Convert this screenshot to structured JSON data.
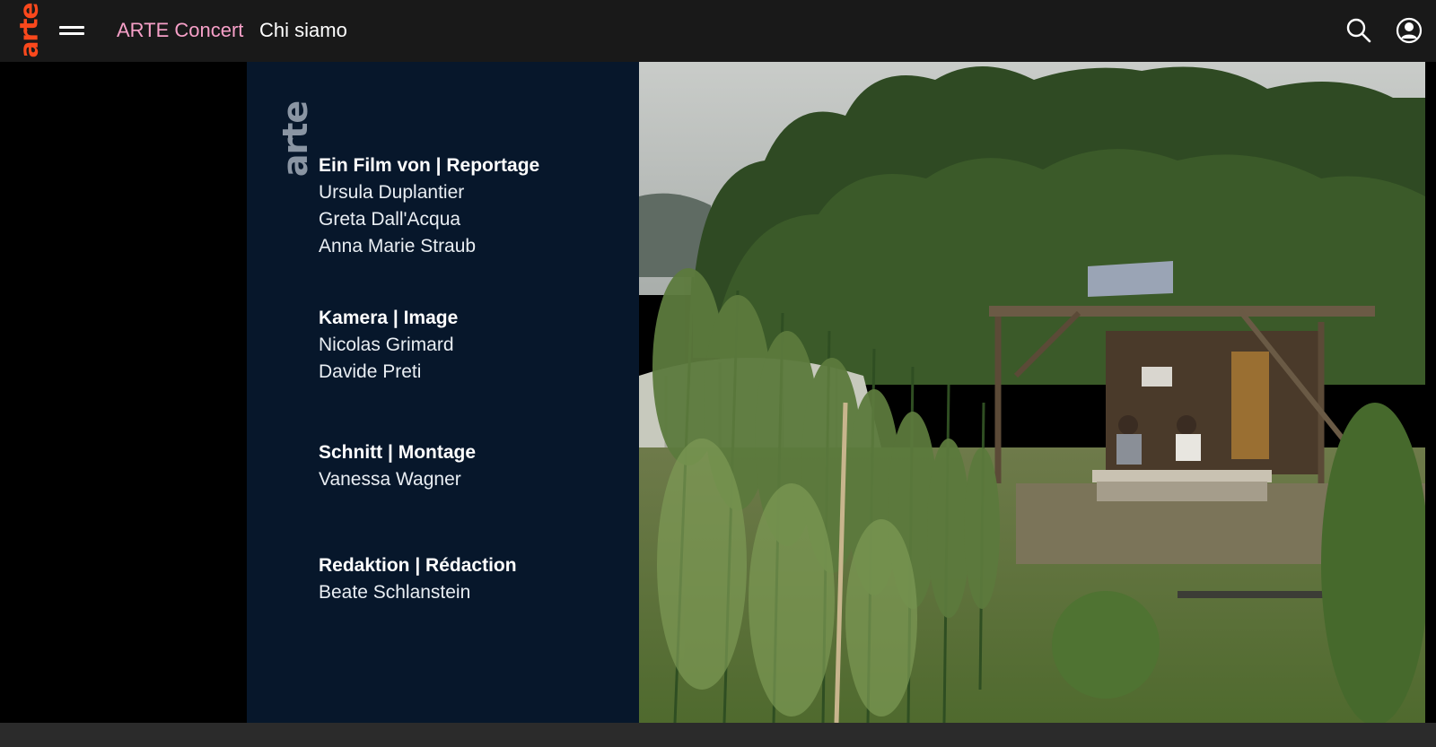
{
  "header": {
    "logo_text": "arte",
    "menu_icon": "hamburger-menu-icon",
    "nav": [
      {
        "label": "ARTE Concert",
        "color": "#f7a0c8"
      },
      {
        "label": "Chi siamo",
        "color": "#ffffff"
      }
    ],
    "search_icon": "search-icon",
    "account_icon": "user-account-icon"
  },
  "credits": {
    "logo_text": "arte",
    "groups": [
      {
        "heading": "Ein Film von | Reportage",
        "names": [
          "Ursula Duplantier",
          "Greta Dall'Acqua",
          "Anna Marie Straub"
        ]
      },
      {
        "heading": "Kamera | Image",
        "names": [
          "Nicolas Grimard",
          "Davide Preti"
        ]
      },
      {
        "heading": "Schnitt | Montage",
        "names": [
          "Vanessa Wagner"
        ]
      },
      {
        "heading": "Redaktion | Rédaction",
        "names": [
          "Beate Schlanstein"
        ]
      }
    ]
  },
  "colors": {
    "header_bg": "#191919",
    "logo": "#fa481c",
    "credits_bg": "#07172b"
  }
}
